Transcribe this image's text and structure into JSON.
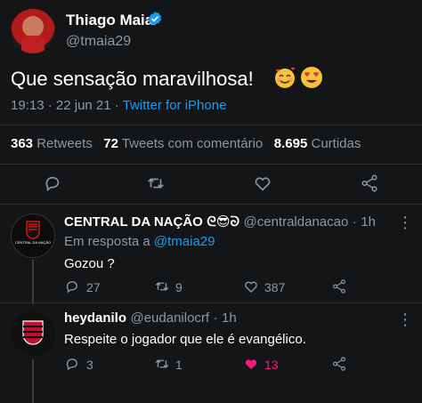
{
  "tweet": {
    "author_name": "Thiago Maia",
    "author_handle": "@tmaia29",
    "text": "Que sensação maravilhosa!",
    "time": "19:13",
    "date": "22 jun 21",
    "source": "Twitter for iPhone",
    "retweets_count": "363",
    "retweets_label": "Retweets",
    "quotes_count": "72",
    "quotes_label": "Tweets com comentário",
    "likes_count": "8.695",
    "likes_label": "Curtidas",
    "emojis": [
      "smiling-face-with-hearts-icon",
      "heart-eyes-icon"
    ]
  },
  "replies": [
    {
      "name": "CENTRAL DA NAÇÃO",
      "name_emoji": "ᘓ😎ᘐ",
      "handle": "@centraldanacao",
      "age": "1h",
      "in_reply_prefix": "Em resposta a",
      "in_reply_handle": "@tmaia29",
      "text": "Gozou ?",
      "replies": "27",
      "retweets": "9",
      "likes": "387",
      "avatar_text": "CENTRAL DA NAÇÃO"
    },
    {
      "name": "heydanilo",
      "handle": "@eudanilocrf",
      "age": "1h",
      "text": "Respeite o jogador que ele é evangélico.",
      "replies": "3",
      "retweets": "1",
      "likes": "13"
    }
  ],
  "colors": {
    "background": "#141517",
    "accent": "#1d9bf0",
    "liked": "#f91880",
    "secondary_text": "#8b98a5"
  }
}
